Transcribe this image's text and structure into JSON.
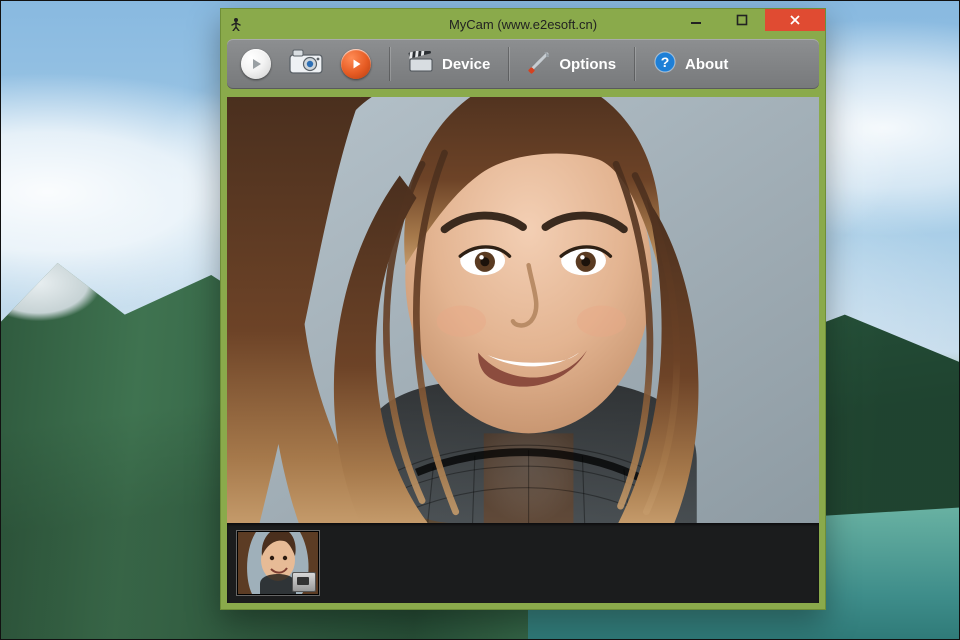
{
  "window": {
    "title": "MyCam (www.e2esoft.cn)"
  },
  "toolbar": {
    "play_name": "play",
    "snapshot_name": "snapshot",
    "record_name": "record",
    "device_label": "Device",
    "options_label": "Options",
    "about_label": "About"
  },
  "icons": {
    "app": "figure-icon",
    "minimize": "minimize-icon",
    "maximize": "maximize-icon",
    "close": "close-icon",
    "play": "play-icon",
    "camera": "camera-icon",
    "record": "record-play-icon",
    "clapper": "clapperboard-icon",
    "tools": "tools-icon",
    "help": "help-icon"
  },
  "preview": {
    "subject": "woman-smiling-long-hair"
  },
  "thumbnails": [
    {
      "id": "shot-1",
      "subject": "woman-smiling-long-hair"
    }
  ]
}
